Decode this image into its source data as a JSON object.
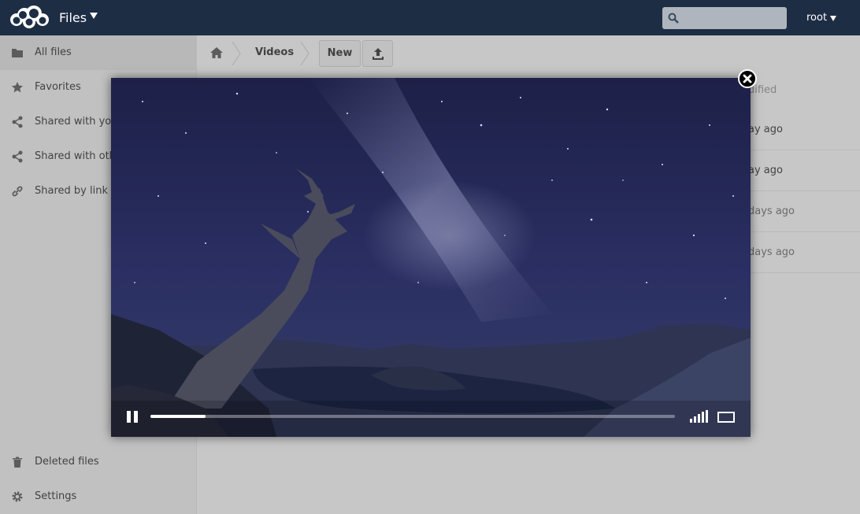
{
  "header": {
    "app_title": "Files",
    "search_placeholder": "",
    "user_name": "root",
    "colors": {
      "background": "#1d2d44",
      "search_bg": "#afb5bd"
    }
  },
  "sidebar": {
    "items": [
      {
        "label": "All files",
        "icon": "folder-icon",
        "active": true
      },
      {
        "label": "Favorites",
        "icon": "star-icon"
      },
      {
        "label": "Shared with you",
        "icon": "share-icon"
      },
      {
        "label": "Shared with others",
        "icon": "share-icon"
      },
      {
        "label": "Shared by link",
        "icon": "link-icon"
      }
    ],
    "footer_items": [
      {
        "label": "Deleted files",
        "icon": "trash-icon"
      },
      {
        "label": "Settings",
        "icon": "gear-icon"
      }
    ]
  },
  "breadcrumb": {
    "items": [
      {
        "icon": "home-icon"
      },
      {
        "label": "Videos"
      }
    ],
    "new_button": "New",
    "upload_icon": "upload-icon"
  },
  "file_list": {
    "modified_header": "dified",
    "rows": [
      {
        "modified": "ay ago"
      },
      {
        "modified": "ay ago"
      },
      {
        "modified": "days ago"
      },
      {
        "modified": "days ago"
      }
    ]
  },
  "video_player": {
    "progress_fraction": 0.105,
    "controls": [
      "pause-icon",
      "volume-icon",
      "fullscreen-icon"
    ],
    "close_icon": "close-icon"
  }
}
